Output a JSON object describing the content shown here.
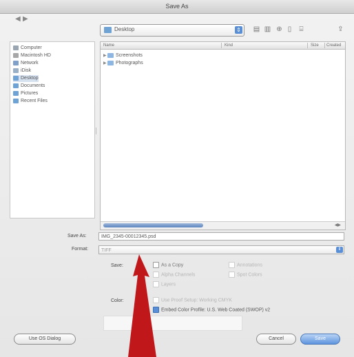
{
  "window": {
    "title": "Save As"
  },
  "toolbar": {
    "back_icon": "arrow-left",
    "forward_icon": "arrow-right",
    "location_label": "Desktop",
    "location_icon": "folder",
    "icons": [
      "list-view-icon",
      "column-view-icon",
      "new-folder-icon",
      "preview-icon",
      "drive-icon",
      "share-icon"
    ]
  },
  "sidebar": {
    "items": [
      {
        "label": "Computer",
        "icon": "computer-icon",
        "color": "#9aa5b2",
        "selected": false
      },
      {
        "label": "Macintosh HD",
        "icon": "drive-icon",
        "color": "#a7a7a7",
        "selected": false
      },
      {
        "label": "Network",
        "icon": "network-icon",
        "color": "#7fa0c8",
        "selected": false
      },
      {
        "label": "iDisk",
        "icon": "disk-icon",
        "color": "#9ab0c7",
        "selected": false
      },
      {
        "label": "Desktop",
        "icon": "desktop-folder-icon",
        "color": "#6fa3d6",
        "selected": true
      },
      {
        "label": "Documents",
        "icon": "folder-icon",
        "color": "#6fa3d6",
        "selected": false
      },
      {
        "label": "Pictures",
        "icon": "folder-icon",
        "color": "#6fa3d6",
        "selected": false
      },
      {
        "label": "Recent Files",
        "icon": "folder-icon",
        "color": "#6fa3d6",
        "selected": false
      }
    ]
  },
  "filelist": {
    "columns": [
      "Name",
      "Kind",
      "Size",
      "Created"
    ],
    "rows": [
      {
        "label": "Screenshots"
      },
      {
        "label": "Photographs"
      }
    ]
  },
  "form": {
    "save_as_label": "Save As:",
    "save_as_value": "IMG_2345-00012345.psd",
    "format_label": "Format:",
    "format_value": "TIFF",
    "save_label": "Save:",
    "color_label": "Color:",
    "options": {
      "as_a_copy": "As a Copy",
      "alpha_channels": "Alpha Channels",
      "layers": "Layers",
      "annotations": "Annotations",
      "spot_colors": "Spot Colors",
      "use_proof_setup": "Use Proof Setup: Working CMYK",
      "embed_color_profile": "Embed Color Profile: U.S. Web Coated (SWOP) v2"
    }
  },
  "buttons": {
    "use_os_dialog": "Use OS Dialog",
    "cancel": "Cancel",
    "save": "Save"
  },
  "colors": {
    "accent": "#5a8fd6",
    "annotation_arrow": "#c0171b"
  }
}
